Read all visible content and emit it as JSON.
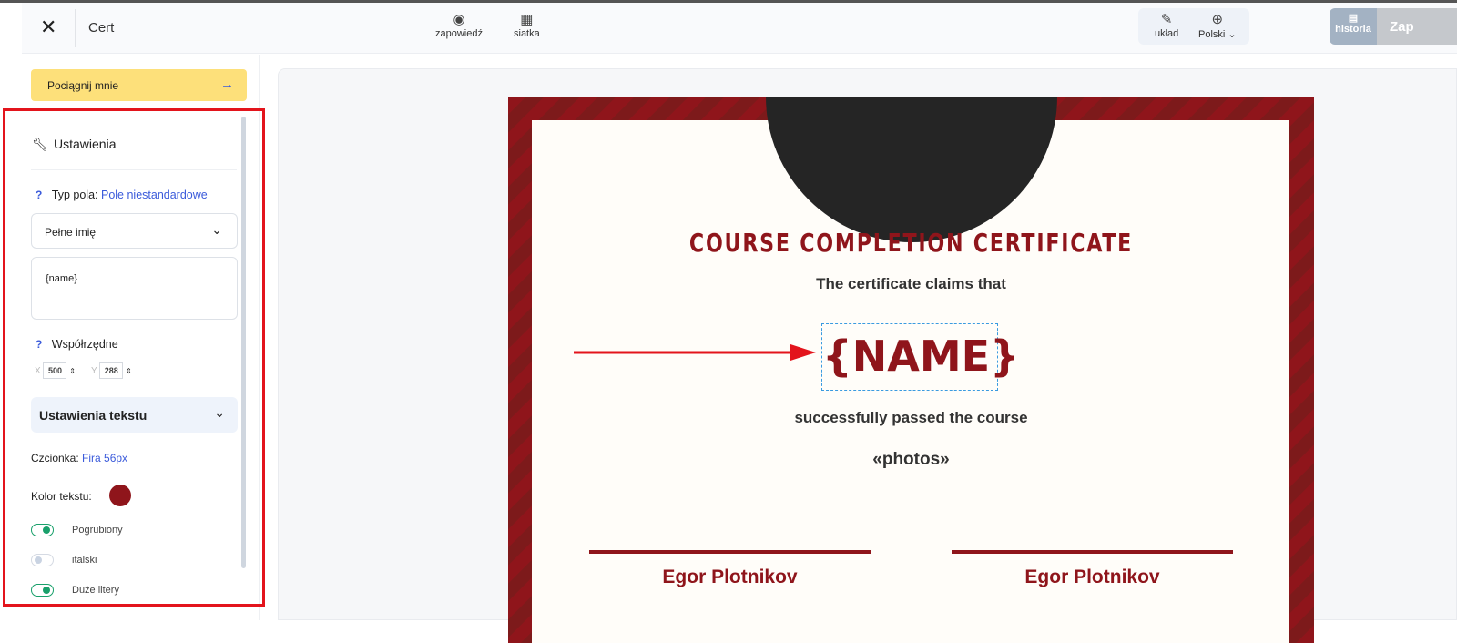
{
  "header": {
    "title": "Cert",
    "preview": "zapowiedź",
    "grid": "siatka",
    "layout": "układ",
    "language": "Polski",
    "history": "historia",
    "save": "Zap"
  },
  "sidebar": {
    "drag_button": "Pociągnij mnie",
    "settings_title": "Ustawienia",
    "field_type_label": "Typ pola:",
    "field_type_value": "Pole niestandardowe",
    "field_select": "Pełne imię",
    "field_text": "{name}",
    "coords_label": "Współrzędne",
    "x_label": "X",
    "x_value": "500",
    "y_label": "Y",
    "y_value": "288",
    "text_settings": "Ustawienia tekstu",
    "font_label": "Czcionka:",
    "font_value": "Fira 56px",
    "color_label": "Kolor tekstu:",
    "text_color": "#8f151b",
    "toggles": [
      {
        "label": "Pogrubiony",
        "on": true
      },
      {
        "label": "italski",
        "on": false
      },
      {
        "label": "Duże litery",
        "on": true
      }
    ]
  },
  "certificate": {
    "title": "COURSE COMPLETION CERTIFICATE",
    "claims": "The certificate claims that",
    "name": "{NAME}",
    "passed": "successfully passed the course",
    "course": "«photos»",
    "signatures": [
      "Egor Plotnikov",
      "Egor Plotnikov"
    ]
  }
}
